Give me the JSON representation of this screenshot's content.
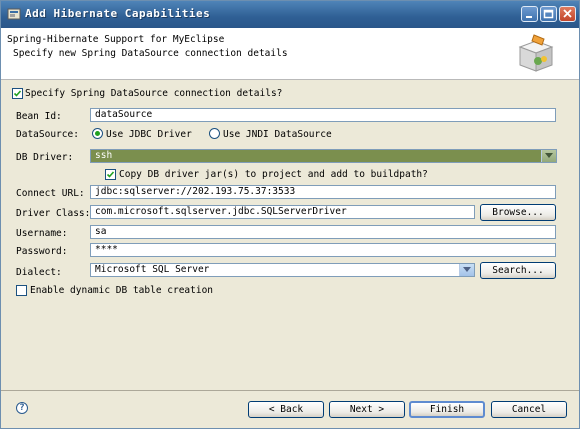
{
  "window": {
    "title": "Add Hibernate Capabilities"
  },
  "header": {
    "title": "Spring-Hibernate Support for MyEclipse",
    "description": "Specify new Spring DataSource connection details"
  },
  "form": {
    "specify_checkbox_label": "Specify Spring DataSource connection details?",
    "specify_checked": true,
    "bean_id_label": "Bean Id:",
    "bean_id_value": "dataSource",
    "datasource_label": "DataSource:",
    "use_jdbc_label": "Use JDBC Driver",
    "use_jndi_label": "Use JNDI DataSource",
    "selected_datasource": "Use JDBC Driver",
    "db_driver_label": "DB Driver:",
    "db_driver_value": "ssh",
    "copy_jar_label": "Copy DB driver jar(s) to project and add to buildpath?",
    "copy_jar_checked": true,
    "connect_url_label": "Connect URL:",
    "connect_url_value": "jdbc:sqlserver://202.193.75.37:3533",
    "driver_class_label": "Driver Class:",
    "driver_class_value": "com.microsoft.sqlserver.jdbc.SQLServerDriver",
    "browse_label": "Browse...",
    "username_label": "Username:",
    "username_value": "sa",
    "password_label": "Password:",
    "password_value": "****",
    "dialect_label": "Dialect:",
    "dialect_value": "Microsoft SQL Server",
    "search_label": "Search...",
    "dynamic_table_label": "Enable dynamic DB table creation",
    "dynamic_table_checked": false
  },
  "footer": {
    "back_label": "< Back",
    "next_label": "Next >",
    "finish_label": "Finish",
    "cancel_label": "Cancel"
  },
  "colors": {
    "titlebar": "#2f5f94",
    "dialog_bg": "#ece9d8",
    "db_driver_bg": "#7b8f4e"
  }
}
